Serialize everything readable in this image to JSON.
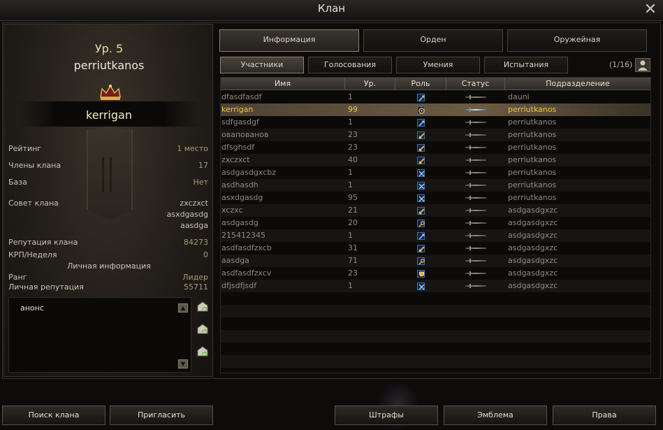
{
  "window": {
    "title": "Клан",
    "close_icon": "close-icon"
  },
  "clan": {
    "level": "Ур. 5",
    "name": "perriutkanos",
    "leader": "kerrigan",
    "stats": [
      {
        "label": "Рейтинг",
        "value": "1 место"
      },
      {
        "label": "Члены клана",
        "value": "17"
      },
      {
        "label": "База",
        "value": "Нет"
      }
    ],
    "council_label": "Совет клана",
    "council": [
      "zxczxct",
      "asxdgasdg",
      "aasdga"
    ],
    "stats2": [
      {
        "label": "Репутация клана",
        "value": "84273"
      },
      {
        "label": "КРП/Неделя",
        "value": "0"
      }
    ],
    "personal_header": "Личная информация",
    "personal": [
      {
        "label": "Ранг",
        "value": "Лидер"
      },
      {
        "label": "Личная репутация",
        "value": "55711"
      }
    ],
    "notice": "анонс"
  },
  "tabs": [
    "Информация",
    "Орден",
    "Оружейная"
  ],
  "subtabs": [
    "Участники",
    "Голосования",
    "Умения",
    "Испытания"
  ],
  "page_counter": "(1/16)",
  "table": {
    "headers": [
      "Имя",
      "Ур.",
      "Роль",
      "Статус",
      "Подразделение"
    ],
    "rows": [
      {
        "name": "dfasdfasdf",
        "level": "1",
        "role": "blue",
        "division": "dauni"
      },
      {
        "name": "kerrigan",
        "level": "99",
        "role": "leader",
        "division": "perriutkanos"
      },
      {
        "name": "sdfgasdgf",
        "level": "1",
        "role": "blue",
        "division": "perriutkanos"
      },
      {
        "name": "овапованов",
        "level": "23",
        "role": "orange",
        "division": "perriutkanos"
      },
      {
        "name": "dfsghsdf",
        "level": "23",
        "role": "orange",
        "division": "perriutkanos"
      },
      {
        "name": "zxczxct",
        "level": "40",
        "role": "orange",
        "division": "perriutkanos"
      },
      {
        "name": "asdgasdgxcbz",
        "level": "1",
        "role": "cross",
        "division": "perriutkanos"
      },
      {
        "name": "asdhasdh",
        "level": "1",
        "role": "cross",
        "division": "perriutkanos"
      },
      {
        "name": "asxdgasdg",
        "level": "95",
        "role": "cross",
        "division": "perriutkanos"
      },
      {
        "name": "xczxc",
        "level": "21",
        "role": "orange",
        "division": "asdgasdgxzc"
      },
      {
        "name": "asdgasdg",
        "level": "20",
        "role": "key",
        "division": "asdgasdgxzc"
      },
      {
        "name": "215412345",
        "level": "1",
        "role": "blue",
        "division": "asdgasdgxzc"
      },
      {
        "name": "asdfasdfzxcb",
        "level": "31",
        "role": "orange",
        "division": "asdgasdgxzc"
      },
      {
        "name": "aasdga",
        "level": "71",
        "role": "key",
        "division": "asdgasdgxzc"
      },
      {
        "name": "asdfasdfzxcv",
        "level": "23",
        "role": "shield",
        "division": "asdgasdgxzc"
      },
      {
        "name": "dfjsdfjsdf",
        "level": "1",
        "role": "cross",
        "division": "asdgasdgxzc"
      }
    ],
    "selected_index": 1
  },
  "bottom_buttons": {
    "search": "Поиск клана",
    "invite": "Пригласить",
    "penalties": "Штрафы",
    "emblem": "Эмблема",
    "rights": "Права"
  },
  "colors": {
    "accent": "#f0c24a",
    "text": "#b5b0a6"
  }
}
